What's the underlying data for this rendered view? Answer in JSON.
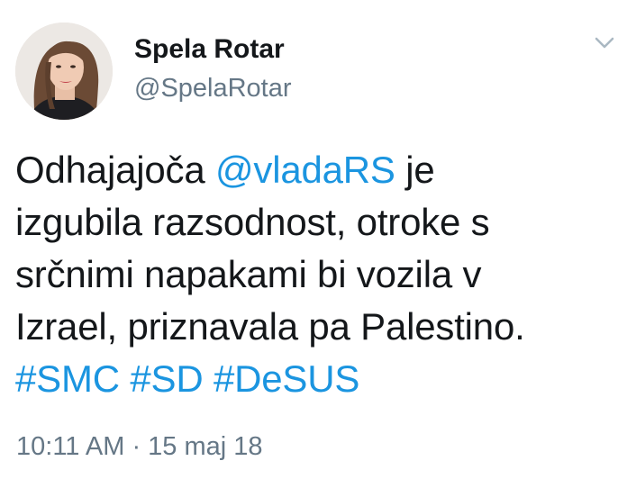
{
  "author": {
    "name": "Spela Rotar",
    "handle": "@SpelaRotar"
  },
  "tweet": {
    "line1_prefix": "Odhajajoča ",
    "mention": "@vladaRS",
    "line1_suffix": " je",
    "line2": "izgubila razsodnost, otroke s",
    "line3": "srčnimi napakami bi vozila v",
    "line4": "Izrael, priznavala pa Palestino.",
    "hashtags": [
      "#SMC",
      "#SD",
      "#DeSUS"
    ]
  },
  "meta": {
    "time": "10:11 AM",
    "separator": " · ",
    "date": "15 maj 18"
  },
  "colors": {
    "link": "#1b95e0",
    "secondary_text": "#657786",
    "primary_text": "#14171a"
  },
  "icons": {
    "menu": "chevron-down-icon"
  }
}
